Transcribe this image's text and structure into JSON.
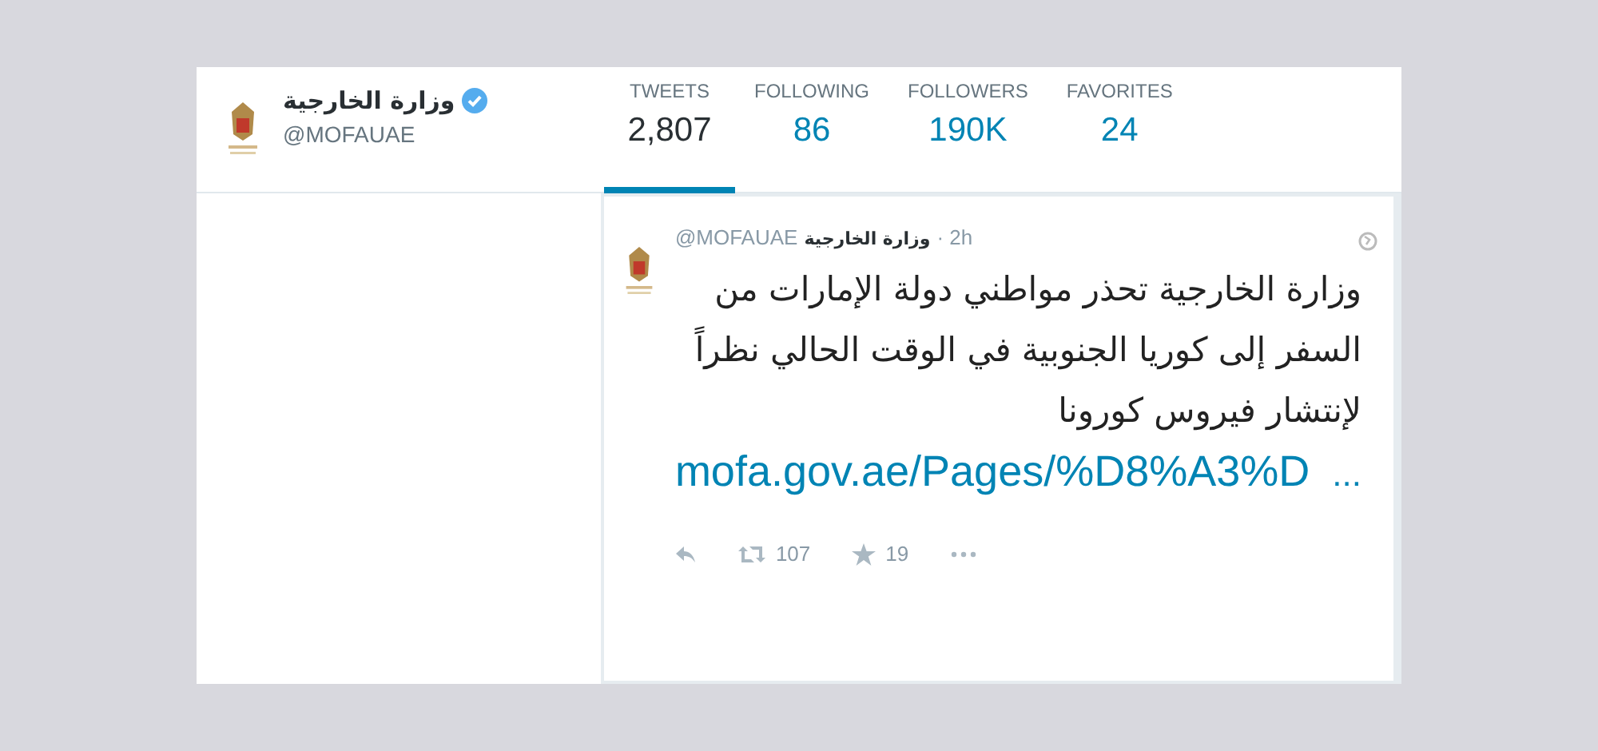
{
  "profile": {
    "name": "وزارة الخارجية",
    "verified": true,
    "handle": "@MOFAUAE"
  },
  "stats": [
    {
      "label": "TWEETS",
      "value": "2,807",
      "selected": true
    },
    {
      "label": "FOLLOWING",
      "value": "86",
      "selected": false
    },
    {
      "label": "FOLLOWERS",
      "value": "190K",
      "selected": false
    },
    {
      "label": "FAVORITES",
      "value": "24",
      "selected": false
    }
  ],
  "tweet": {
    "name": "وزارة الخارجية",
    "handle": "@MOFAUAE",
    "time": "· 2h",
    "text": "وزارة الخارجية تحذر مواطني دولة الإمارات من السفر إلى كوريا الجنوبية في الوقت الحالي نظراً لإنتشار فيروس كورونا",
    "link": "mofa.gov.ae/Pages/%D8%A3%D",
    "ellipsis": "...",
    "actions": [
      {
        "kind": "reply"
      },
      {
        "kind": "retweet",
        "count": "107"
      },
      {
        "kind": "favorite",
        "count": "19"
      },
      {
        "kind": "more"
      }
    ]
  }
}
